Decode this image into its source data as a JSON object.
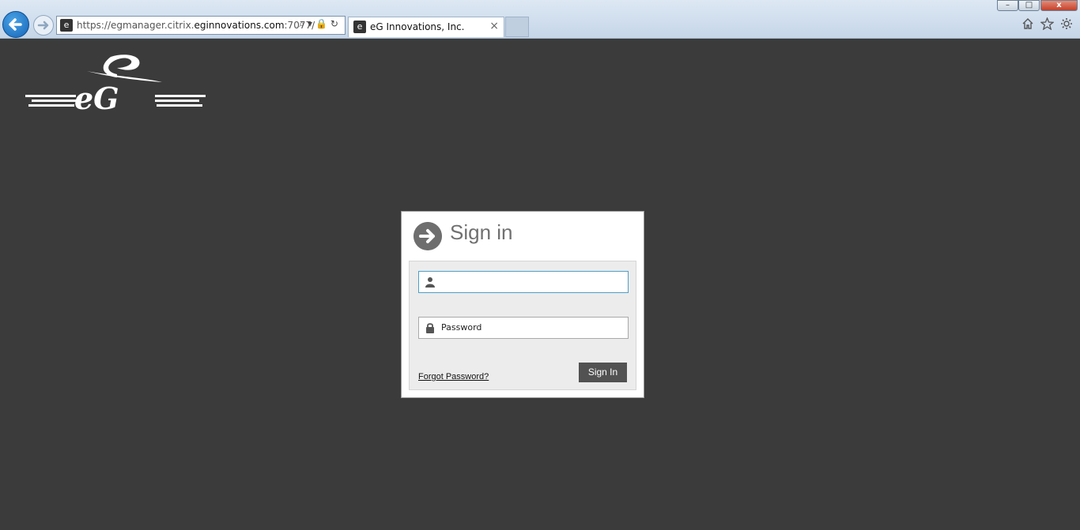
{
  "browser": {
    "url_prefix": "https://egmanager.citrix.",
    "url_domain": "eginnovations.com",
    "url_suffix": ":7077/",
    "tab_title": "eG Innovations, Inc.",
    "tab_close": "×",
    "favicon_glyph": "e",
    "win_minimize": "–",
    "win_maximize": "□",
    "win_close": "x",
    "addr_icons": "⌕▾🔒↻"
  },
  "colors": {
    "page_background": "#3b3b3b",
    "accent": "#4f9fc9",
    "button": "#525252"
  },
  "login": {
    "title": "Sign in",
    "username_value": "",
    "password_placeholder": "Password",
    "forgot_label": "Forgot Password?",
    "submit_label": "Sign In"
  },
  "icons": [
    "back-arrow-icon",
    "forward-arrow-icon",
    "search-icon",
    "lock-icon",
    "refresh-icon",
    "home-icon",
    "star-icon",
    "gear-icon",
    "user-icon",
    "padlock-icon",
    "sign-in-arrow-icon"
  ]
}
